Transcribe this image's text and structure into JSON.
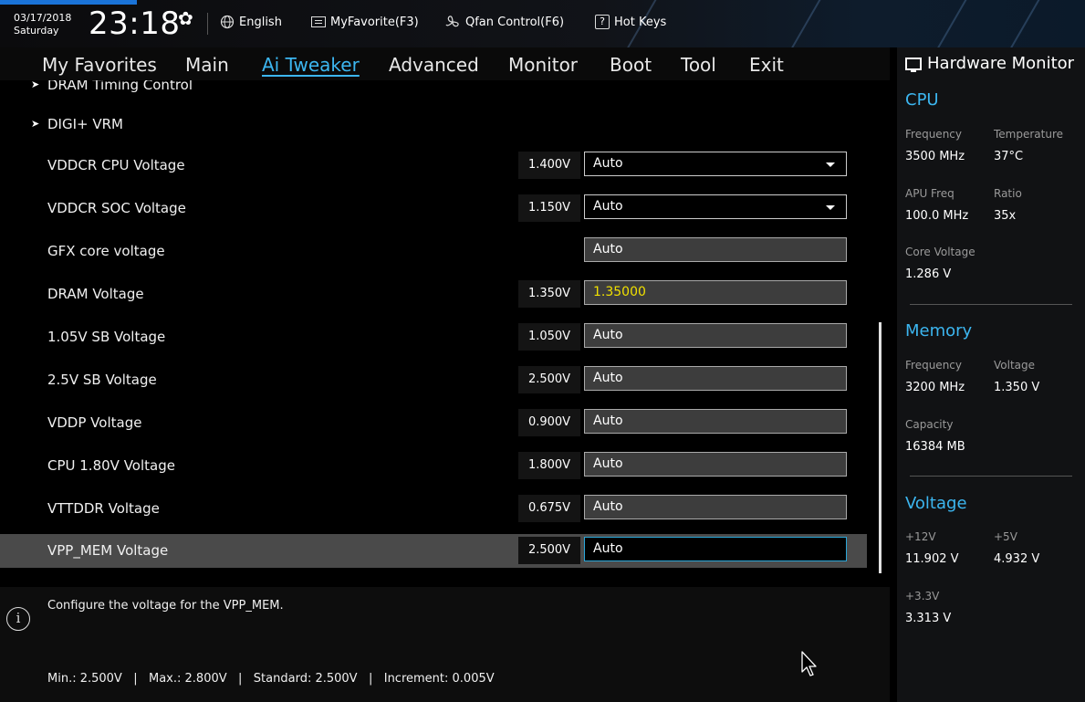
{
  "header": {
    "date": "03/17/2018",
    "weekday": "Saturday",
    "time": "23:18",
    "language": "English",
    "myfavorite": "MyFavorite(F3)",
    "qfan": "Qfan Control(F6)",
    "hotkeys": "Hot Keys",
    "hotkeys_icon_glyph": "?"
  },
  "nav": {
    "tabs": [
      "My Favorites",
      "Main",
      "Ai Tweaker",
      "Advanced",
      "Monitor",
      "Boot",
      "Tool",
      "Exit"
    ],
    "active": "Ai Tweaker"
  },
  "settings": [
    {
      "label": "DRAM Timing Control",
      "submenu": true,
      "value": null,
      "field": null
    },
    {
      "label": "DIGI+ VRM",
      "submenu": true,
      "value": null,
      "field": null
    },
    {
      "label": "VDDCR CPU Voltage",
      "value": "1.400V",
      "field": "Auto",
      "style": "dropdown"
    },
    {
      "label": "VDDCR SOC Voltage",
      "value": "1.150V",
      "field": "Auto",
      "style": "dropdown"
    },
    {
      "label": "GFX core voltage",
      "value": "",
      "field": "Auto",
      "style": "box"
    },
    {
      "label": "DRAM Voltage",
      "value": "1.350V",
      "field": "1.35000",
      "style": "highlight"
    },
    {
      "label": "1.05V SB Voltage",
      "value": "1.050V",
      "field": "Auto",
      "style": "box"
    },
    {
      "label": "2.5V SB Voltage",
      "value": "2.500V",
      "field": "Auto",
      "style": "box"
    },
    {
      "label": "VDDP Voltage",
      "value": "0.900V",
      "field": "Auto",
      "style": "box"
    },
    {
      "label": "CPU 1.80V Voltage",
      "value": "1.800V",
      "field": "Auto",
      "style": "box"
    },
    {
      "label": "VTTDDR Voltage",
      "value": "0.675V",
      "field": "Auto",
      "style": "box"
    },
    {
      "label": "VPP_MEM Voltage",
      "value": "2.500V",
      "field": "Auto",
      "style": "focused",
      "selected": true
    }
  ],
  "help": {
    "description": "Configure the voltage for the VPP_MEM.",
    "specs": "Min.: 2.500V   |   Max.: 2.800V   |   Standard: 2.500V   |   Increment: 0.005V"
  },
  "hardware_monitor": {
    "title": "Hardware Monitor",
    "cpu": {
      "heading": "CPU",
      "frequency_label": "Frequency",
      "frequency": "3500 MHz",
      "temperature_label": "Temperature",
      "temperature": "37°C",
      "apu_freq_label": "APU Freq",
      "apu_freq": "100.0 MHz",
      "ratio_label": "Ratio",
      "ratio": "35x",
      "core_voltage_label": "Core Voltage",
      "core_voltage": "1.286 V"
    },
    "memory": {
      "heading": "Memory",
      "frequency_label": "Frequency",
      "frequency": "3200 MHz",
      "voltage_label": "Voltage",
      "voltage": "1.350 V",
      "capacity_label": "Capacity",
      "capacity": "16384 MB"
    },
    "voltage": {
      "heading": "Voltage",
      "v12_label": "+12V",
      "v12": "11.902 V",
      "v5_label": "+5V",
      "v5": "4.932 V",
      "v33_label": "+3.3V",
      "v33": "3.313 V"
    }
  },
  "colors": {
    "accent_blue": "#3cb6f0",
    "highlight_yellow": "#f0e000",
    "selected_row": "#4a4a4a"
  }
}
